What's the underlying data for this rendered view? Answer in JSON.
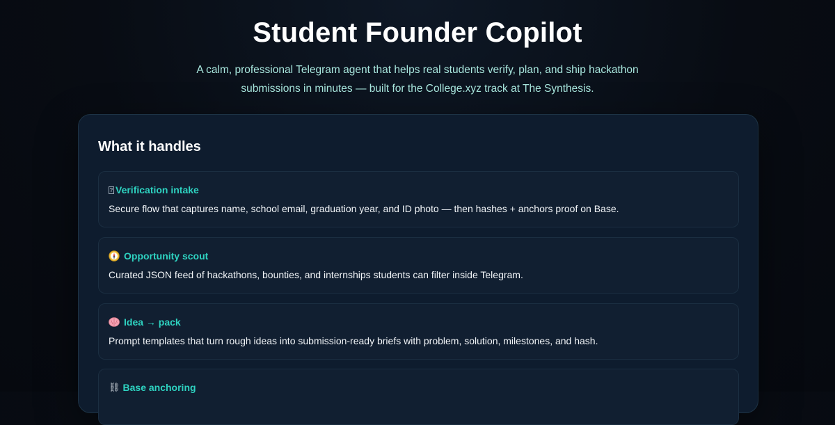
{
  "hero": {
    "title": "Student Founder Copilot",
    "subtitle": "A calm, professional Telegram agent that helps real students verify, plan, and ship hackathon submissions in minutes — built for the College.xyz track at The Synthesis."
  },
  "panel": {
    "title": "What it handles",
    "cards": [
      {
        "icon": "missing-glyph-icon",
        "title": "Verification intake",
        "body": "Secure flow that captures name, school email, graduation year, and ID photo — then hashes + anchors proof on Base."
      },
      {
        "icon": "compass-icon",
        "title": "Opportunity scout",
        "body": "Curated JSON feed of hackathons, bounties, and internships students can filter inside Telegram."
      },
      {
        "icon": "brain-icon",
        "title": "Idea → pack",
        "body": "Prompt templates that turn rough ideas into submission-ready briefs with problem, solution, milestones, and hash."
      },
      {
        "icon": "chain-icon",
        "title": "Base anchoring",
        "body": ""
      }
    ]
  },
  "colors": {
    "background": "#080c13",
    "panel": "#0e1c2e",
    "card": "#111f31",
    "accent": "#2ed3c1",
    "subtitle": "#a9e7de"
  }
}
